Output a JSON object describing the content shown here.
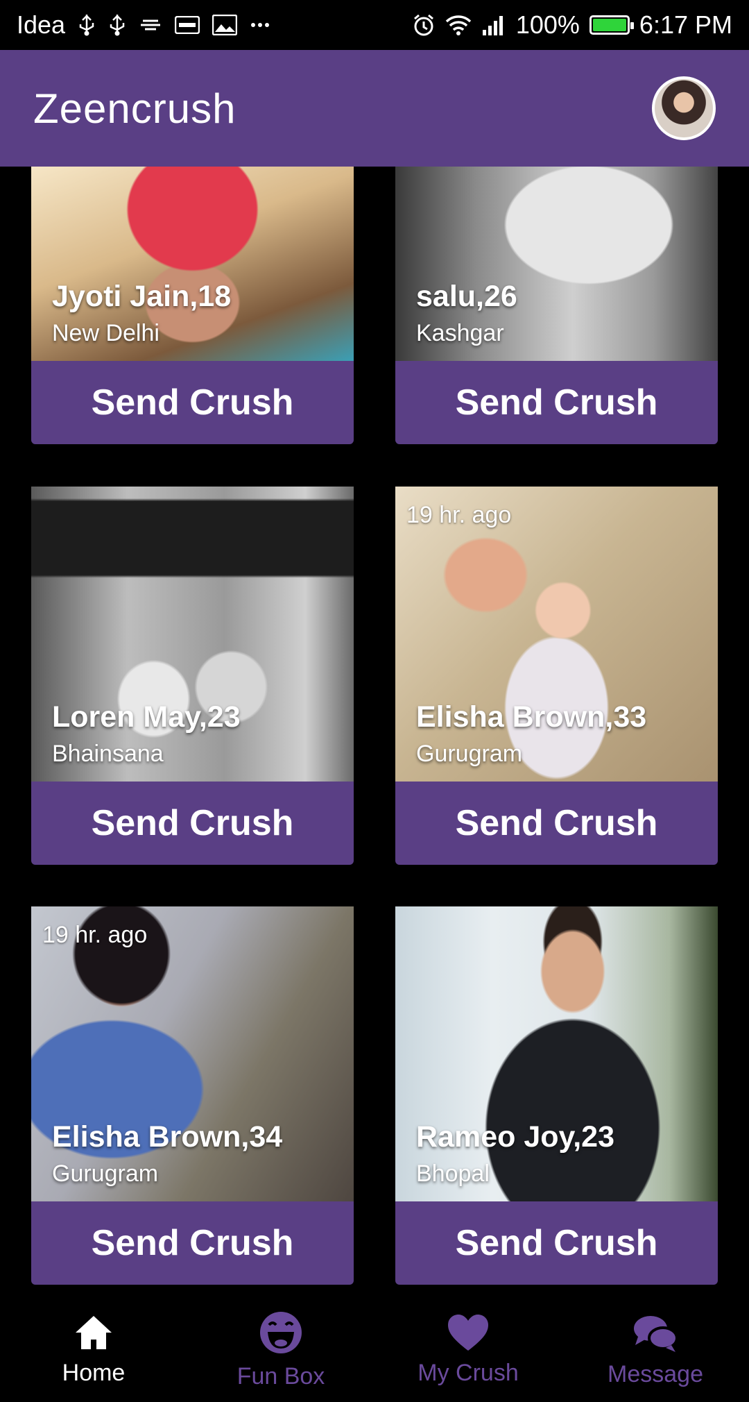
{
  "status_bar": {
    "carrier": "Idea",
    "battery": "100%",
    "time": "6:17 PM",
    "battery_level": 1.0
  },
  "app_bar": {
    "title": "Zeencrush"
  },
  "cards": [
    {
      "name": "Jyoti Jain,18",
      "city": "New Delhi",
      "time": "",
      "button": "Send Crush"
    },
    {
      "name": "salu,26",
      "city": "Kashgar",
      "time": "",
      "button": "Send Crush"
    },
    {
      "name": "Loren May,23",
      "city": "Bhainsana",
      "time": "",
      "button": "Send Crush"
    },
    {
      "name": "Elisha Brown,33",
      "city": "Gurugram",
      "time": "19 hr. ago",
      "button": "Send Crush"
    },
    {
      "name": "Elisha Brown,34",
      "city": "Gurugram",
      "time": "19 hr. ago",
      "button": "Send Crush"
    },
    {
      "name": "Rameo Joy,23",
      "city": "Bhopal",
      "time": "",
      "button": "Send Crush"
    }
  ],
  "bottom_nav": [
    {
      "label": "Home",
      "icon": "home-icon",
      "active": true
    },
    {
      "label": "Fun Box",
      "icon": "laugh-icon",
      "active": false
    },
    {
      "label": "My Crush",
      "icon": "heart-icon",
      "active": false
    },
    {
      "label": "Message",
      "icon": "chat-icon",
      "active": false
    }
  ],
  "colors": {
    "primary": "#5a3f85",
    "nav_inactive": "#6a4a9c",
    "background": "#000000"
  }
}
